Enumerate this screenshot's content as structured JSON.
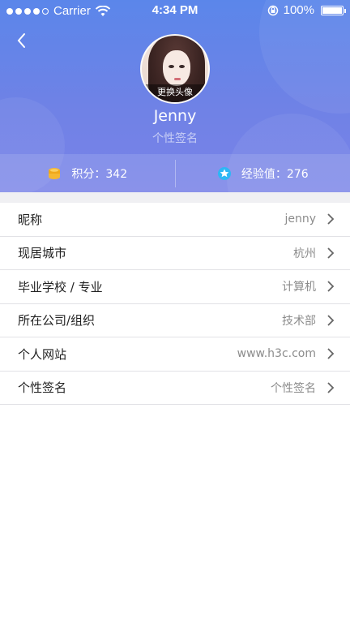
{
  "status_bar": {
    "carrier": "Carrier",
    "time": "4:34 PM",
    "battery": "100%"
  },
  "profile": {
    "avatar_label": "更换头像",
    "name": "Jenny",
    "signature": "个性签名"
  },
  "stats": [
    {
      "icon": "coins-icon",
      "text": "积分：342",
      "color": "#f5b731"
    },
    {
      "icon": "star-badge-icon",
      "text": "经验值：276",
      "color": "#2db7f5"
    }
  ],
  "rows": [
    {
      "label": "昵称",
      "value": "jenny"
    },
    {
      "label": "现居城市",
      "value": "杭州"
    },
    {
      "label": "毕业学校 / 专业",
      "value": "计算机"
    },
    {
      "label": "所在公司/组织",
      "value": "技术部"
    },
    {
      "label": "个人网站",
      "value": "www.h3c.com"
    },
    {
      "label": "个性签名",
      "value": "个性签名"
    }
  ],
  "colors": {
    "header_top": "#5b86ea",
    "header_bottom": "#7a83e8"
  }
}
